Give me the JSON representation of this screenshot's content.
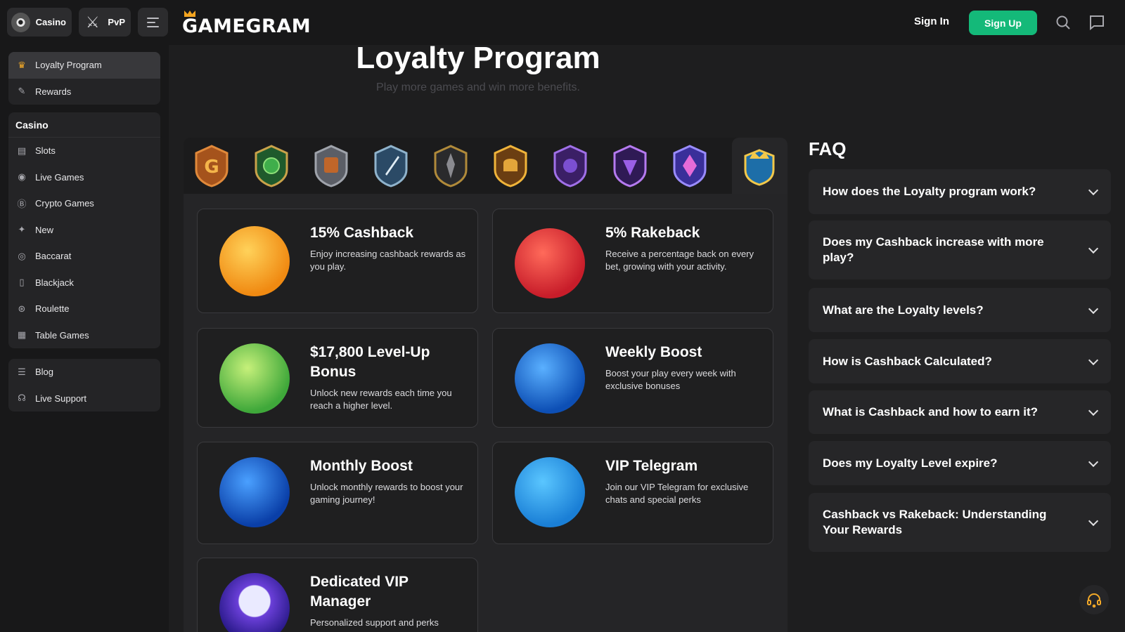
{
  "header": {
    "modes": [
      {
        "label": "Casino",
        "icon": "casino-chip-icon"
      },
      {
        "label": "PvP",
        "icon": "crossed-swords-icon"
      }
    ],
    "logo": "GAMEGRAM",
    "sign_in": "Sign In",
    "sign_up": "Sign Up",
    "accent": "#14b979"
  },
  "sidebar": {
    "top_items": [
      {
        "label": "Loyalty Program",
        "icon": "crown-icon",
        "active": true
      },
      {
        "label": "Rewards",
        "icon": "rewards-icon"
      }
    ],
    "casino_heading": "Casino",
    "casino_items": [
      {
        "label": "Slots",
        "icon": "slots-icon"
      },
      {
        "label": "Live Games",
        "icon": "live-games-icon"
      },
      {
        "label": "Crypto Games",
        "icon": "crypto-icon"
      },
      {
        "label": "New",
        "icon": "new-icon"
      },
      {
        "label": "Baccarat",
        "icon": "baccarat-icon"
      },
      {
        "label": "Blackjack",
        "icon": "blackjack-icon"
      },
      {
        "label": "Roulette",
        "icon": "roulette-icon"
      },
      {
        "label": "Table Games",
        "icon": "table-games-icon"
      }
    ],
    "bottom_items": [
      {
        "label": "Blog",
        "icon": "blog-icon"
      },
      {
        "label": "Live Support",
        "icon": "headset-icon"
      }
    ]
  },
  "main": {
    "title": "Loyalty Program",
    "subtitle": "Play more games and win more benefits.",
    "tiers": [
      "bronze-g-badge",
      "green-gem-badge",
      "copper-shield-badge",
      "silver-sword-badge",
      "dark-steel-badge",
      "gold-helmet-badge",
      "purple-dragon-badge",
      "violet-dragon-badge",
      "crystal-badge",
      "crown-badge"
    ],
    "active_tier_index": 9,
    "benefits": [
      {
        "title": "15% Cashback",
        "desc": "Enjoy increasing cashback rewards as you play."
      },
      {
        "title": "5% Rakeback",
        "desc": "Receive a percentage back on every bet, growing with your activity."
      },
      {
        "title": "$17,800 Level-Up Bonus",
        "desc": "Unlock new rewards each time you reach a higher level."
      },
      {
        "title": "Weekly Boost",
        "desc": "Boost your play every week with exclusive bonuses"
      },
      {
        "title": "Monthly Boost",
        "desc": "Unlock monthly rewards to boost your gaming journey!"
      },
      {
        "title": "VIP Telegram",
        "desc": "Join our VIP Telegram for exclusive chats and special perks"
      },
      {
        "title": "Dedicated VIP Manager",
        "desc": "Personalized support and perks"
      }
    ]
  },
  "faq": {
    "title": "FAQ",
    "items": [
      "How does the Loyalty program work?",
      "Does my Cashback increase with more play?",
      "What are the Loyalty levels?",
      "How is Cashback Calculated?",
      "What is Cashback and how to earn it?",
      "Does my Loyalty Level expire?",
      "Cashback vs Rakeback: Understanding Your Rewards"
    ]
  }
}
